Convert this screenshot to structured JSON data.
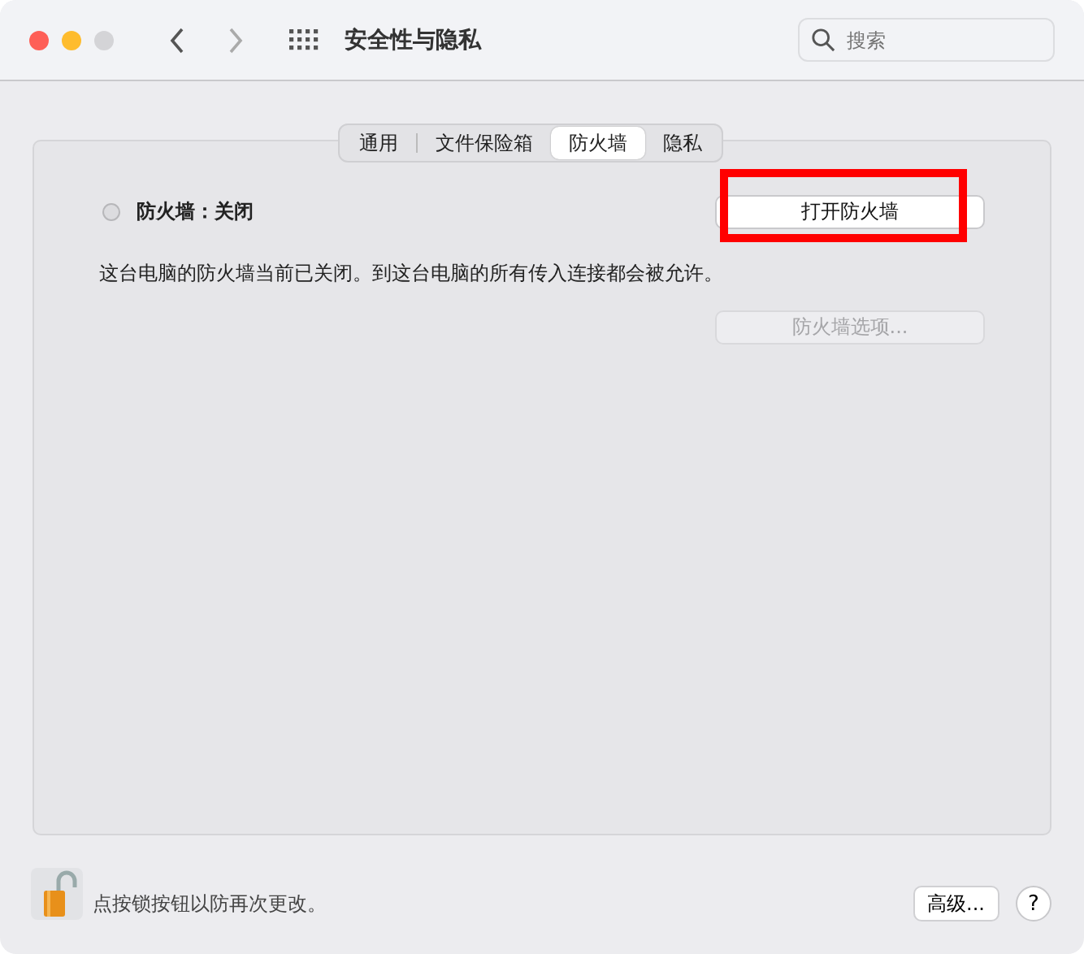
{
  "window": {
    "title": "安全性与隐私"
  },
  "search": {
    "placeholder": "搜索"
  },
  "tabs": [
    {
      "label": "通用",
      "selected": false
    },
    {
      "label": "文件保险箱",
      "selected": false
    },
    {
      "label": "防火墙",
      "selected": true
    },
    {
      "label": "隐私",
      "selected": false
    }
  ],
  "firewall": {
    "status_label": "防火墙：关闭",
    "on": false,
    "description": "这台电脑的防火墙当前已关闭。到这台电脑的所有传入连接都会被允许。"
  },
  "buttons": [
    {
      "label": "打开防火墙",
      "disabled": false,
      "highlighted": true
    },
    {
      "label": "防火墙选项...",
      "disabled": true,
      "highlighted": false
    }
  ],
  "footer": {
    "lock_text": "点按锁按钮以防再次更改。",
    "locked": false,
    "advanced_button": "高级...",
    "help_button": "?"
  }
}
